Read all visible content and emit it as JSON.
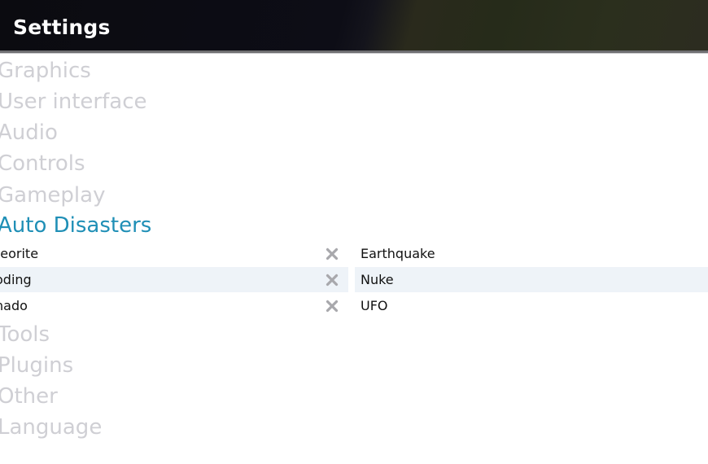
{
  "header": {
    "title": "Settings"
  },
  "categories": [
    {
      "label": "Graphics"
    },
    {
      "label": "User interface"
    },
    {
      "label": "Audio"
    },
    {
      "label": "Controls"
    },
    {
      "label": "Gameplay"
    },
    {
      "label": "Auto Disasters"
    },
    {
      "label": "Tools"
    },
    {
      "label": "Plugins"
    },
    {
      "label": "Other"
    },
    {
      "label": "Language"
    }
  ],
  "disasters": {
    "enabled": [
      {
        "label": "teorite"
      },
      {
        "label": "oding"
      },
      {
        "label": "nado"
      }
    ],
    "available": [
      {
        "label": "Earthquake"
      },
      {
        "label": "Nuke"
      },
      {
        "label": "UFO"
      }
    ]
  },
  "icons": {
    "remove": "close-x-icon"
  },
  "colors": {
    "accent": "#1f8fb6",
    "inactive_category": "#cfcfd4",
    "row_alt": "#eef3f8",
    "remove_icon": "#a8a8ac"
  }
}
